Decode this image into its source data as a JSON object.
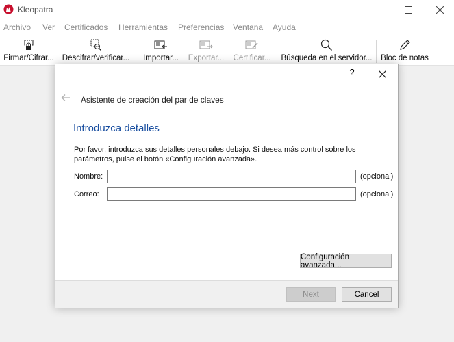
{
  "window": {
    "title": "Kleopatra",
    "minimize": "—",
    "maximize": "☐",
    "close": "✕"
  },
  "menu": [
    "Archivo",
    "Ver",
    "Certificados",
    "Herramientas",
    "Preferencias",
    "Ventana",
    "Ayuda"
  ],
  "toolbar": {
    "sign_encrypt": "Firmar/Cifrar...",
    "decrypt_verify": "Descifrar/verificar...",
    "import": "Importar...",
    "export": "Exportar...",
    "certify": "Certificar...",
    "search_server": "Búsqueda en el servidor...",
    "notepad": "Bloc de notas"
  },
  "dialog": {
    "help": "?",
    "wizard_title": "Asistente de creación del par de claves",
    "page_title": "Introduzca detalles",
    "instructions": "Por favor, introduzca sus detalles personales debajo. Si desea más control sobre los parámetros, pulse el botón «Configuración avanzada».",
    "name_label": "Nombre:",
    "name_value": "",
    "name_optional": "(opcional)",
    "email_label": "Correo:",
    "email_value": "",
    "email_optional": "(opcional)",
    "advanced_button": "Configuración avanzada...",
    "next_button": "Next",
    "cancel_button": "Cancel"
  },
  "colors": {
    "accent_blue": "#1a4fa0",
    "app_icon_red": "#c8102e"
  }
}
